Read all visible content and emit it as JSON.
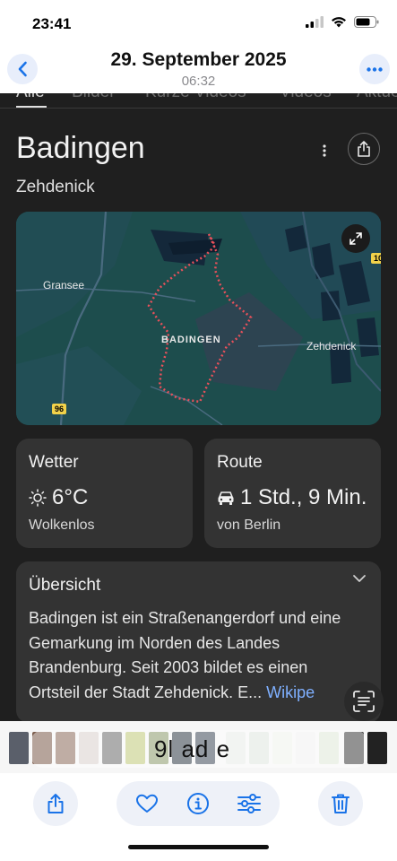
{
  "status_bar": {
    "time": "23:41"
  },
  "header": {
    "title": "29. September 2025",
    "subtitle": "06:32"
  },
  "tabs": [
    "Alle",
    "Bilder",
    "Kurze Videos",
    "Videos",
    "Aktuell"
  ],
  "place": {
    "title": "Badingen",
    "subtitle": "Zehdenick"
  },
  "map": {
    "labels": {
      "west": "Gransee",
      "center": "BADINGEN",
      "east": "Zehdenick"
    },
    "road_badges": [
      "96",
      "10"
    ]
  },
  "weather": {
    "title": "Wetter",
    "temperature": "6°C",
    "condition": "Wolkenlos"
  },
  "route": {
    "title": "Route",
    "duration": "1 Std., 9 Min.",
    "from": "von Berlin"
  },
  "overview": {
    "title": "Übersicht",
    "text": "Badingen ist ein Straßenangerdorf und eine Gemarkung im Norden des Landes Brandenburg. Seit 2003 bildet es einen Ortsteil der Stadt Zehdenick. E...",
    "more": "Wikipe"
  },
  "strip": {
    "overlay_text": "9l ad  e"
  },
  "colors": {
    "accent": "#1a73e8",
    "dark_bg": "#1f1f1f",
    "card_bg": "#333333",
    "route_dots": "#e8505a"
  }
}
